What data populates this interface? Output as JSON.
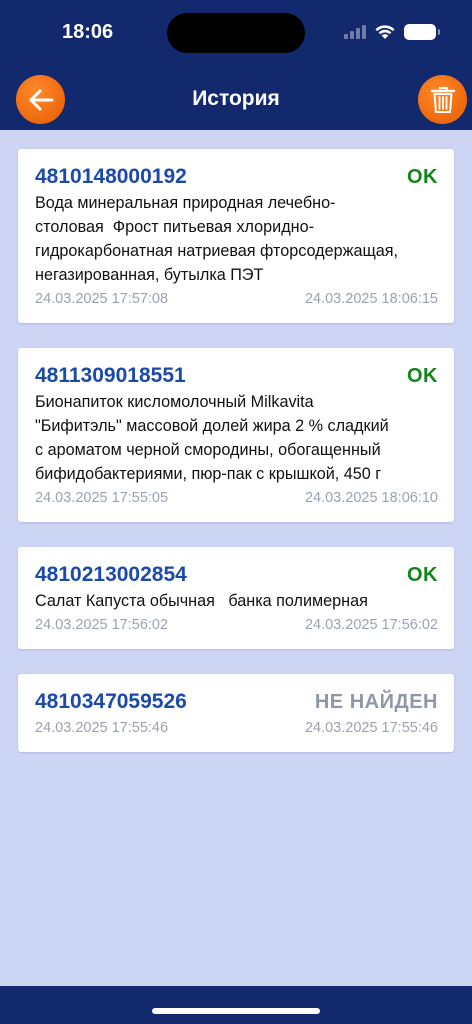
{
  "status_bar": {
    "time": "18:06"
  },
  "header": {
    "title": "История",
    "back_icon": "arrow-left-icon",
    "trash_icon": "trash-icon",
    "accent_color": "#f06d10",
    "bar_color": "#13296d"
  },
  "history": [
    {
      "barcode": "4810148000192",
      "status": "OK",
      "status_color": "#14851c",
      "description": "Вода минеральная природная лечебно-\nстоловая  Фрост питьевая хлоридно-\nгидрокарбонатная натриевая фторсодержащая,\nнегазированная, бутылка ПЭТ",
      "date_left": "24.03.2025 17:57:08",
      "date_right": "24.03.2025 18:06:15"
    },
    {
      "barcode": "4811309018551",
      "status": "OK",
      "status_color": "#14851c",
      "description": "Бионапиток кисломолочный Milkavita\n\"Бифитэль\" массовой долей жира 2 % сладкий\nс ароматом черной смородины, обогащенный\nбифидобактериями, пюр-пак с крышкой, 450 г",
      "date_left": "24.03.2025 17:55:05",
      "date_right": "24.03.2025 18:06:10"
    },
    {
      "barcode": "4810213002854",
      "status": "OK",
      "status_color": "#14851c",
      "description": "Салат Капуста обычная   банка полимерная",
      "date_left": "24.03.2025 17:56:02",
      "date_right": "24.03.2025 17:56:02"
    },
    {
      "barcode": "4810347059526",
      "status": "НЕ НАЙДЕН",
      "status_color": "#8f97a8",
      "description": "",
      "date_left": "24.03.2025 17:55:46",
      "date_right": "24.03.2025 17:55:46"
    }
  ]
}
